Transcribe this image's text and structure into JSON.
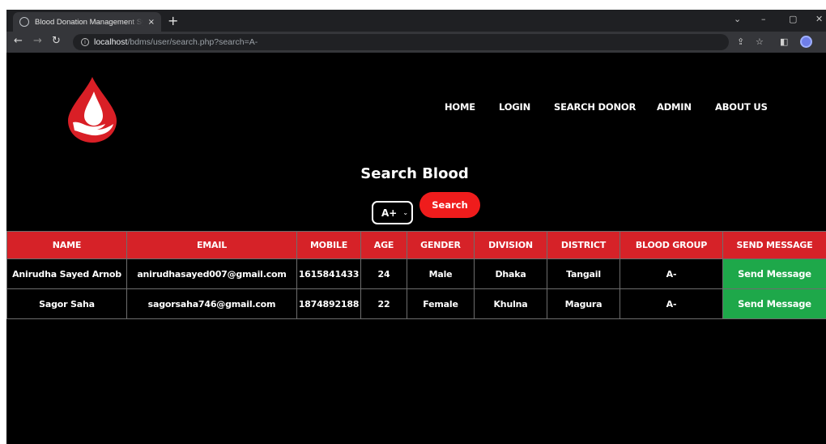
{
  "browser": {
    "tab_title": "Blood Donation Management Sy",
    "tab_close": "×",
    "new_tab": "+",
    "url_host": "localhost",
    "url_path": "/bdms/user/search.php?search=A-"
  },
  "nav": {
    "items": [
      "HOME",
      "LOGIN",
      "SEARCH DONOR",
      "ADMIN",
      "ABOUT US"
    ]
  },
  "search": {
    "heading": "Search Blood",
    "selected_group": "A+",
    "button_label": "Search"
  },
  "table": {
    "headers": [
      "NAME",
      "EMAIL",
      "MOBILE",
      "AGE",
      "GENDER",
      "DIVISION",
      "DISTRICT",
      "BLOOD GROUP",
      "SEND MESSAGE"
    ],
    "rows": [
      {
        "name": "Anirudha Sayed Arnob",
        "email": "anirudhasayed007@gmail.com",
        "mobile": "1615841433",
        "age": "24",
        "gender": "Male",
        "division": "Dhaka",
        "district": "Tangail",
        "blood_group": "A-",
        "action": "Send Message"
      },
      {
        "name": "Sagor Saha",
        "email": "sagorsaha746@gmail.com",
        "mobile": "1874892188",
        "age": "22",
        "gender": "Female",
        "division": "Khulna",
        "district": "Magura",
        "blood_group": "A-",
        "action": "Send Message"
      }
    ]
  },
  "colors": {
    "brand_red": "#d62228",
    "button_red": "#ef1c1c",
    "action_green": "#1ea84a"
  }
}
